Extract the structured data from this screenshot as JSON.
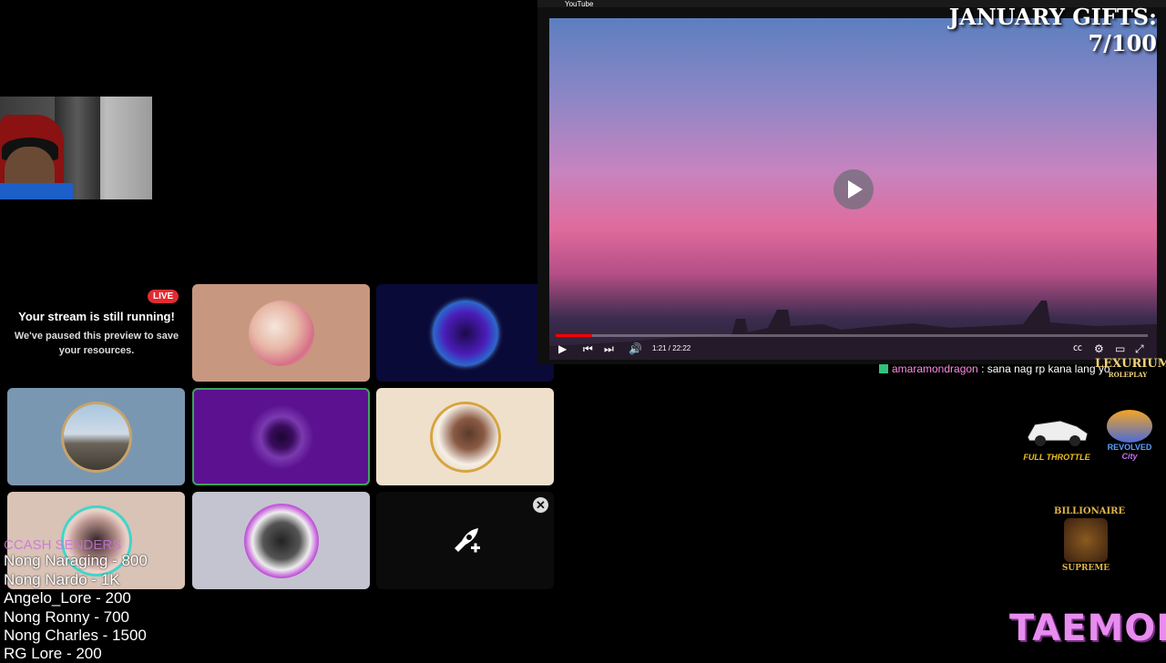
{
  "discord": {
    "live_badge": "LIVE",
    "paused_title": "Your stream is still running!",
    "paused_description": "We've paused this preview to save your resources.",
    "tile_colors": [
      "#c8977f",
      "#0a0a38",
      "#7a97b2",
      "#5c1190",
      "#efe0cc",
      "#d9c2b6",
      "#c3c4cf",
      "#0b0b0b"
    ],
    "close_symbol": "✕"
  },
  "cash_senders": {
    "title": "CCASH SENDERS",
    "entries": [
      "Nong Naraging - 800",
      "Nong Nardo - 1K",
      "Angelo_Lore - 200",
      "Nong Ronny - 700",
      "Nong Charles - 1500",
      "RG Lore - 200"
    ]
  },
  "youtube": {
    "brand": "YouTube",
    "time": "1:21 / 22:22",
    "progress_fraction": 0.061,
    "icons": [
      "play-icon",
      "previous-icon",
      "next-icon",
      "volume-icon",
      "captions-icon",
      "settings-icon",
      "miniplayer-icon",
      "fullscreen-icon"
    ]
  },
  "overlay": {
    "gifts_label": "JANUARY GIFTS: 7/100"
  },
  "chat": {
    "username": "amaramondragon",
    "message": " : sana nag rp kana lang yo"
  },
  "logos": {
    "lexurium": "LEXURIUM",
    "lexurium_sub": "ROLEPLAY",
    "full_throttle": "FULL THROTTLE",
    "revolved": "REVOLVED",
    "revolved_sub": "City",
    "billionaire": "BILLIONAIRE",
    "billionaire_sub": "SUPREME",
    "taemon": "TAEMON"
  }
}
